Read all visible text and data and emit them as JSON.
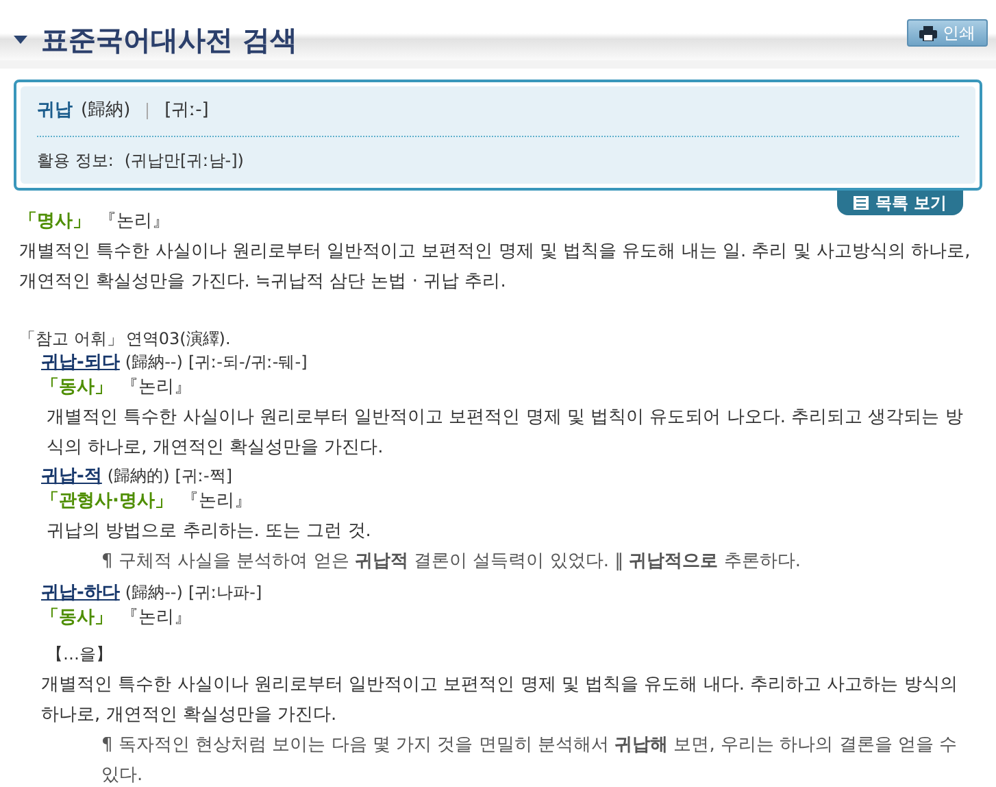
{
  "title": "표준국어대사전 검색",
  "print_button": "인쇄",
  "entry": {
    "headword": "귀납",
    "hanja": "(歸納)",
    "pronunciation": "[귀ː-]",
    "conjugation_label": "활용 정보:",
    "conjugation": "(귀납만[귀ː남-])"
  },
  "list_button": "목록 보기",
  "sense": {
    "pos": "「명사」",
    "field": "『논리』",
    "definition": "개별적인 특수한 사실이나 원리로부터 일반적이고 보편적인 명제 및 법칙을 유도해 내는 일. 추리 및 사고방식의 하나로, 개연적인 확실성만을 가진다. ≒귀납적 삼단 논법 · 귀납 추리."
  },
  "reference": {
    "label": "「참고 어휘」",
    "text": "연역03(演繹)."
  },
  "derivatives": [
    {
      "headword": "귀납-되다",
      "hanja": "(歸納--)",
      "pronunciation": "[귀ː-되-/귀ː-뒈-]",
      "pos": "「동사」",
      "field": "『논리』",
      "definition": "개별적인 특수한 사실이나 원리로부터 일반적이고 보편적인 명제 및 법칙이 유도되어 나오다. 추리되고 생각되는 방식의 하나로, 개연적인 확실성만을 가진다."
    },
    {
      "headword": "귀납-적",
      "hanja": "(歸納的)",
      "pronunciation": "[귀ː-쩍]",
      "pos": "「관형사·명사」",
      "field": "『논리』",
      "definition": "귀납의 방법으로 추리하는. 또는 그런 것.",
      "examples": [
        "¶ 구체적 사실을 분석하여 얻은 **귀납적** 결론이 설득력이 있었다. ‖ **귀납적으로** 추론하다."
      ]
    },
    {
      "headword": "귀납-하다",
      "hanja": "(歸納--)",
      "pronunciation": "[귀ː나파-]",
      "pos": "「동사」",
      "field": "『논리』",
      "pattern": "【…을】",
      "definition": "개별적인 특수한 사실이나 원리로부터 일반적이고 보편적인 명제 및 법칙을 유도해 내다. 추리하고 사고하는 방식의 하나로, 개연적인 확실성만을 가진다.",
      "examples": [
        "¶ 독자적인 현상처럼 보이는 다음 몇 가지 것을 면밀히 분석해서 **귀납해** 보면, 우리는 하나의 결론을 얻을 수 있다."
      ]
    }
  ]
}
